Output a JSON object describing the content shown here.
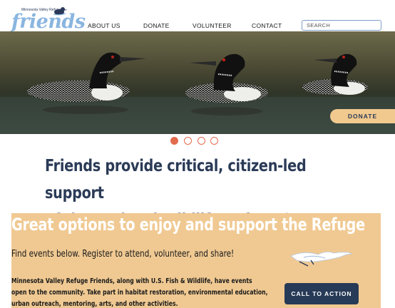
{
  "header": {
    "logo": {
      "small_text": "Minnesota Valley Refuge",
      "word": "friends"
    },
    "nav": [
      {
        "label": "ABOUT US"
      },
      {
        "label": "DONATE"
      },
      {
        "label": "VOLUNTEER"
      },
      {
        "label": "CONTACT"
      }
    ],
    "search": {
      "placeholder": "SEARCH",
      "value": ""
    }
  },
  "hero": {
    "donate_label": "DONATE",
    "slides": {
      "count": 4,
      "active": 1
    }
  },
  "headline": {
    "line1": "Friends provide critical, citizen-led support",
    "line2": "of the National Wildlife Refuge System."
  },
  "events": {
    "title": "Great options to enjoy and support the Refuge",
    "subtitle": "Find events below. Register to attend, volunteer, and share!",
    "body": "Minnesota Valley Refuge Friends, along with U.S. Fish & Wildlife, have events open to the community. Take part in habitat restoration, environmental education, urban outreach, mentoring, arts, and other activities.",
    "cta_label": "CALL TO ACTION"
  },
  "colors": {
    "accent_orange": "#f0c992",
    "navy": "#273a57",
    "dot_red": "#e26b4e",
    "logo_blue": "#8ab6e0"
  }
}
